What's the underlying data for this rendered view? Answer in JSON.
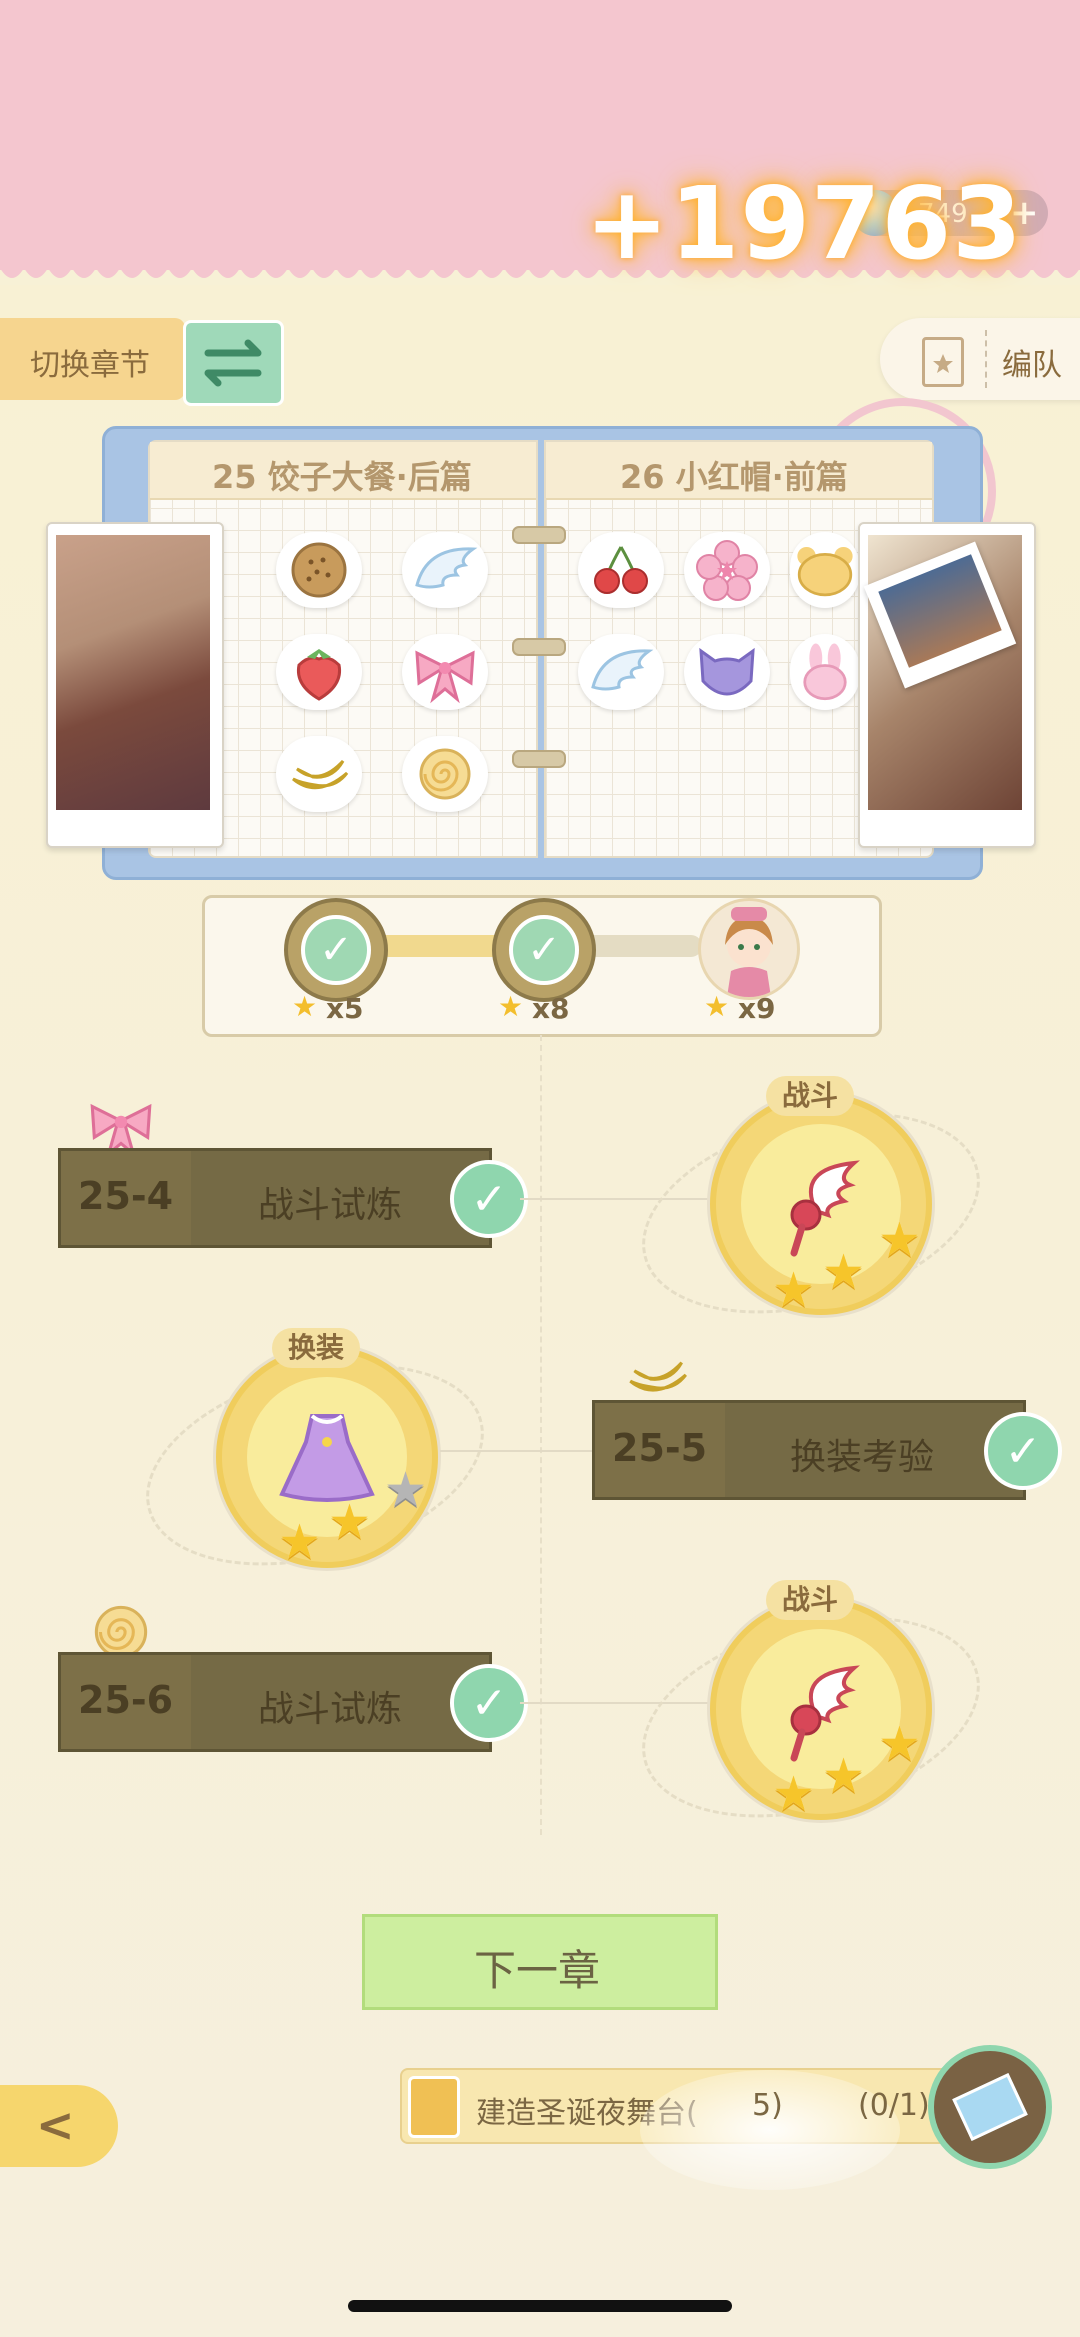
{
  "header": {
    "reward_popup": "+19763",
    "currency_value": "749",
    "currency_add": "+"
  },
  "toolbar": {
    "switch_chapter_label": "切换章节",
    "team_label": "编队"
  },
  "book": {
    "left_chapter_title": "25 饺子大餐·后篇",
    "right_chapter_title": "26 小红帽·前篇",
    "left_icons": [
      "cookie-icon",
      "wing-icon",
      "strawberry-icon",
      "bow-icon",
      "banana-icon",
      "swiss-roll-icon"
    ],
    "right_icons": [
      "cherry-icon",
      "sakura-icon",
      "bear-icon",
      "wing-icon",
      "cat-icon",
      "bunny-icon"
    ]
  },
  "progress": {
    "milestones": [
      {
        "req": "x5",
        "claimed": true
      },
      {
        "req": "x8",
        "claimed": true
      },
      {
        "req": "x9",
        "claimed": false
      }
    ]
  },
  "stages": [
    {
      "num": "25-4",
      "name": "战斗试炼",
      "completed": true,
      "token": "bow-icon"
    },
    {
      "num": "25-5",
      "name": "换装考验",
      "completed": true,
      "token": "banana-icon"
    },
    {
      "num": "25-6",
      "name": "战斗试炼",
      "completed": true,
      "token": "swiss-roll-icon"
    }
  ],
  "nodes": [
    {
      "tag": "战斗",
      "icon": "wing-staff-icon",
      "stars": 3,
      "max_stars": 3
    },
    {
      "tag": "换装",
      "icon": "dress-icon",
      "stars": 2,
      "max_stars": 3
    },
    {
      "tag": "战斗",
      "icon": "wing-staff-icon",
      "stars": 3,
      "max_stars": 3
    }
  ],
  "next_chapter_label": "下一章",
  "task": {
    "label": "建造圣诞夜舞台(",
    "label_tail": "5)",
    "count": "(0/1)"
  },
  "colors": {
    "top_band": "#f4c6cf",
    "background": "#f7f1d6",
    "check_green": "#8fd6ae",
    "stage_bar": "#756a45",
    "node_yellow": "#f4d777",
    "next_button": "#cdee9f"
  }
}
